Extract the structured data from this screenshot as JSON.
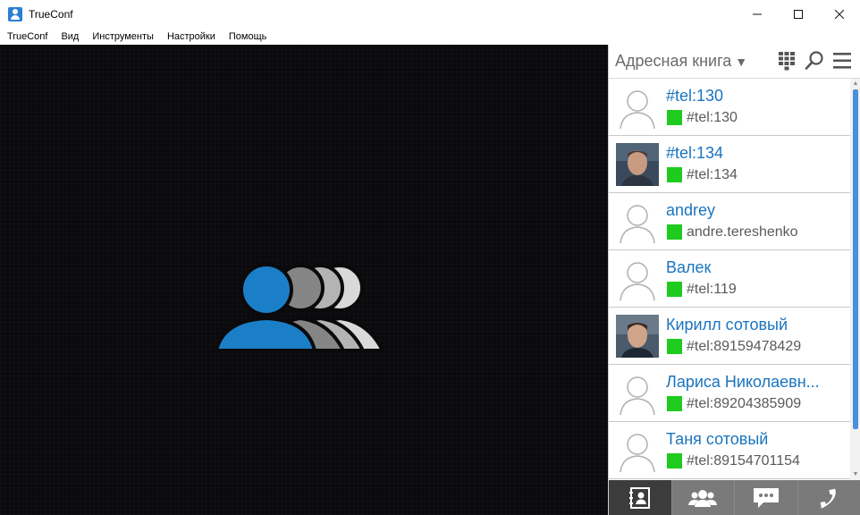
{
  "window": {
    "title": "TrueConf",
    "controls": [
      "minimize-icon",
      "maximize-icon",
      "close-icon"
    ]
  },
  "menu": [
    "TrueConf",
    "Вид",
    "Инструменты",
    "Настройки",
    "Помощь"
  ],
  "address_book": {
    "title": "Адресная книга",
    "header_icons": [
      "dialpad-icon",
      "search-icon",
      "menu-icon"
    ],
    "contacts": [
      {
        "name": "#tel:130",
        "status": "online",
        "id": "#tel:130",
        "avatar": "placeholder"
      },
      {
        "name": "#tel:134",
        "status": "online",
        "id": "#tel:134",
        "avatar": "photo"
      },
      {
        "name": "andrey",
        "status": "online",
        "id": "andre.tereshenko",
        "avatar": "placeholder"
      },
      {
        "name": "Валек",
        "status": "online",
        "id": "#tel:119",
        "avatar": "placeholder"
      },
      {
        "name": "Кирилл сотовый",
        "status": "online",
        "id": "#tel:89159478429",
        "avatar": "photo"
      },
      {
        "name": "Лариса Николаевн...",
        "status": "online",
        "id": "#tel:89204385909",
        "avatar": "placeholder"
      },
      {
        "name": "Таня сотовый",
        "status": "online",
        "id": "#tel:89154701154",
        "avatar": "placeholder"
      }
    ]
  },
  "bottom_tabs": [
    "address-book-tab",
    "conferences-tab",
    "chat-tab",
    "call-tab"
  ],
  "colors": {
    "accent": "#1a74bf",
    "online": "#1ecb1e",
    "logo_primary": "#1b7fc8"
  }
}
